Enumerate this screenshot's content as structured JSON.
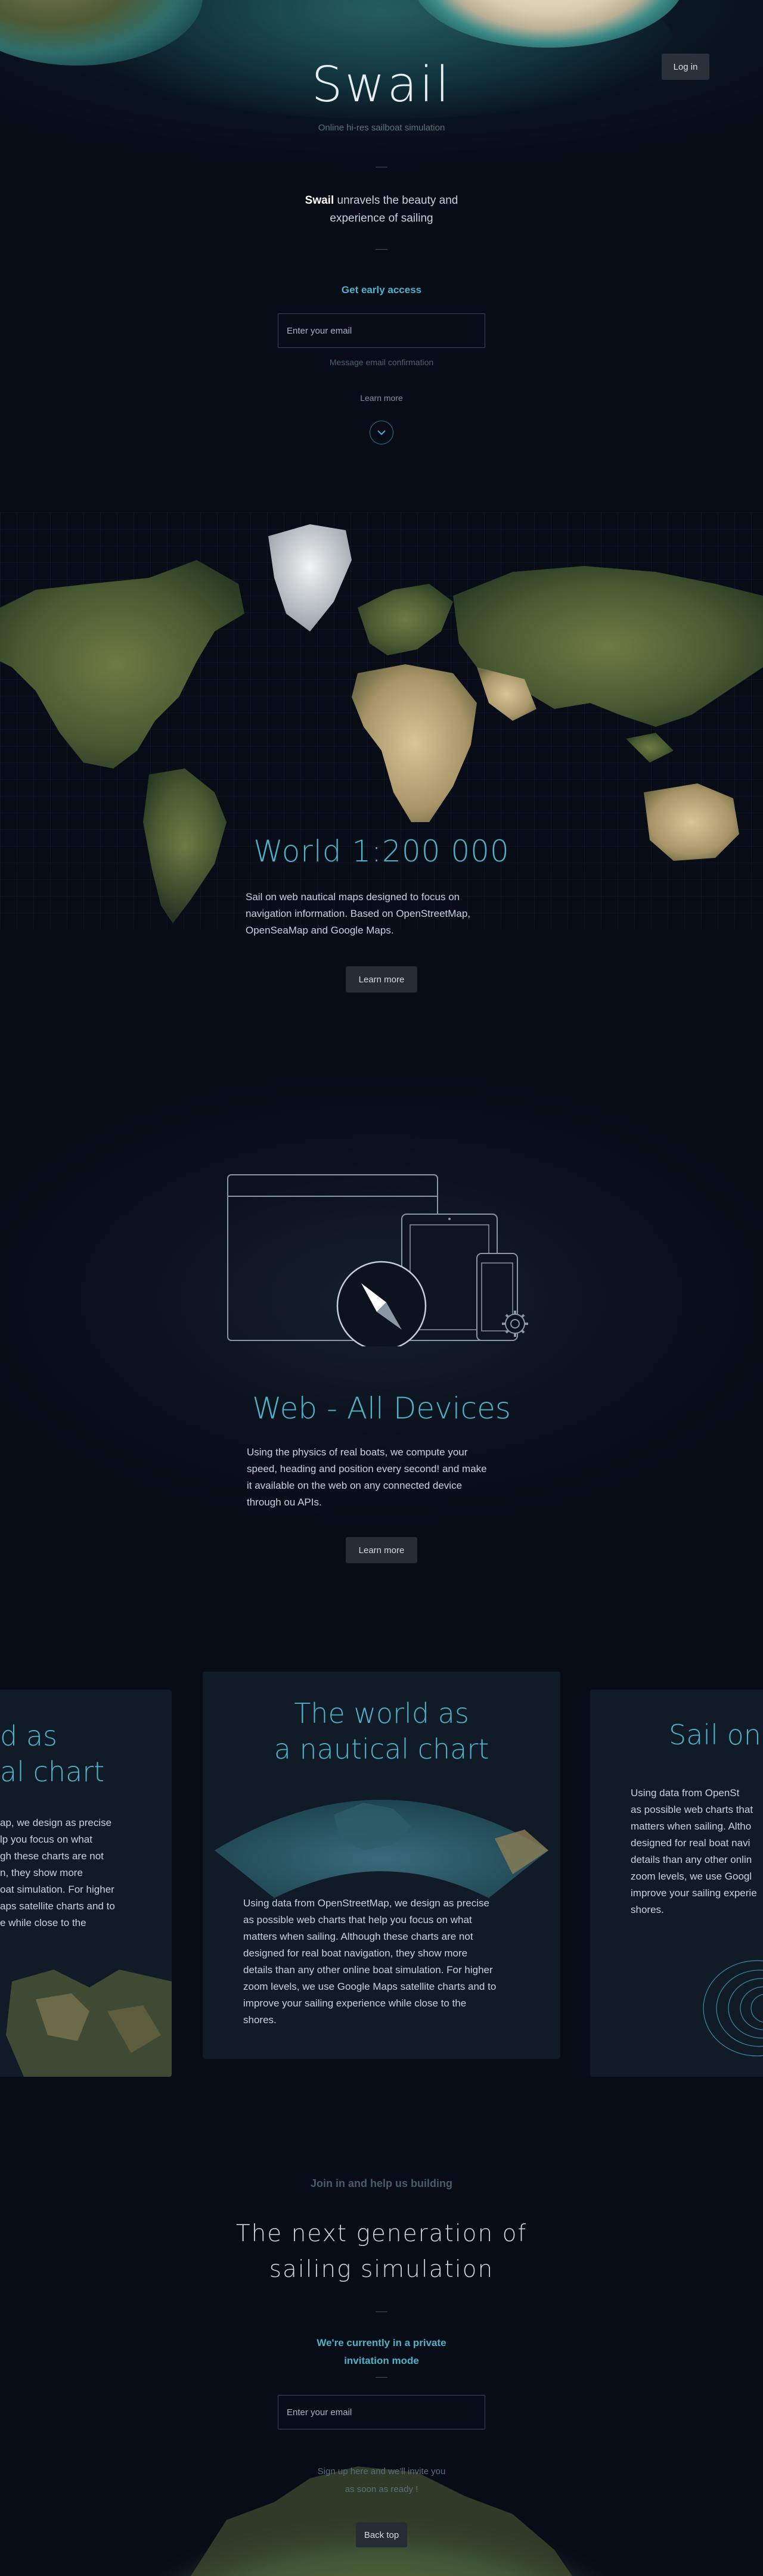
{
  "header": {
    "login_label": "Log in",
    "title": "Swail",
    "subtitle": "Online hi-res sailboat simulation"
  },
  "hero": {
    "tagline_brand": "Swail",
    "tagline_line1": "unravels the beauty and",
    "tagline_line2": "experience of sailing",
    "cta_heading": "Get early access",
    "email_placeholder": "Enter your email",
    "email_note": "Message email confirmation",
    "learn_more": "Learn more",
    "scroll_icon": "chevron-down-icon"
  },
  "map_section": {
    "title": "World 1:200 000",
    "desc_line1": "Sail on web nautical maps designed to focus on",
    "desc_line2": "navigation information. Based on OpenStreetMap,",
    "desc_line3": "OpenSeaMap and Google Maps.",
    "button": "Learn more"
  },
  "devices_section": {
    "title": "Web - All Devices",
    "desc_line1": "Using the physics of real boats, we compute your",
    "desc_line2": "speed, heading and position every second! and make",
    "desc_line3": "it available on the web on any connected device",
    "desc_line4": "through ou APIs.",
    "button": "Learn more",
    "icons": [
      "desktop-icon",
      "tablet-icon",
      "phone-icon",
      "compass-icon",
      "gear-icon"
    ]
  },
  "cards": {
    "left": {
      "title_line1": "d as",
      "title_line2": "al chart",
      "lines": [
        "ap, we design as precise",
        "lp you focus on what",
        "gh these charts are not",
        "n, they show more",
        "oat simulation. For higher",
        "aps satellite charts and to",
        "e while close to the"
      ]
    },
    "center": {
      "title_line1": "The world as",
      "title_line2": "a nautical chart",
      "lines": [
        "Using data from OpenStreetMap, we design as precise",
        "as possible web charts that help you focus on what",
        "matters when sailing. Although these charts are not",
        "designed for real boat navigation, they show more",
        "details than any other online boat simulation. For higher",
        "zoom levels, we use Google Maps satellite charts and to",
        "improve your sailing experience while close to the",
        "shores."
      ]
    },
    "right": {
      "title_line1": "Sail on t",
      "lines": [
        "Using data from OpenSt",
        "as possible web charts that",
        "matters when sailing. Altho",
        "designed for real boat navi",
        "details than any other onlin",
        "zoom levels, we use Googl",
        "improve your sailing experie",
        "shores."
      ]
    }
  },
  "join": {
    "label": "Join in and help us building",
    "title_line1": "The next generation of",
    "title_line2": "sailing simulation",
    "private_line1": "We're currently in a private",
    "private_line2": "invitation mode",
    "email_placeholder": "Enter your email",
    "note_line1": "Sign up here and we'll invite you",
    "note_line2": "as soon as ready !",
    "back_top": "Back top"
  },
  "colors": {
    "background": "#070c17",
    "accent": "#4fb3c8",
    "button": "#262d37"
  }
}
